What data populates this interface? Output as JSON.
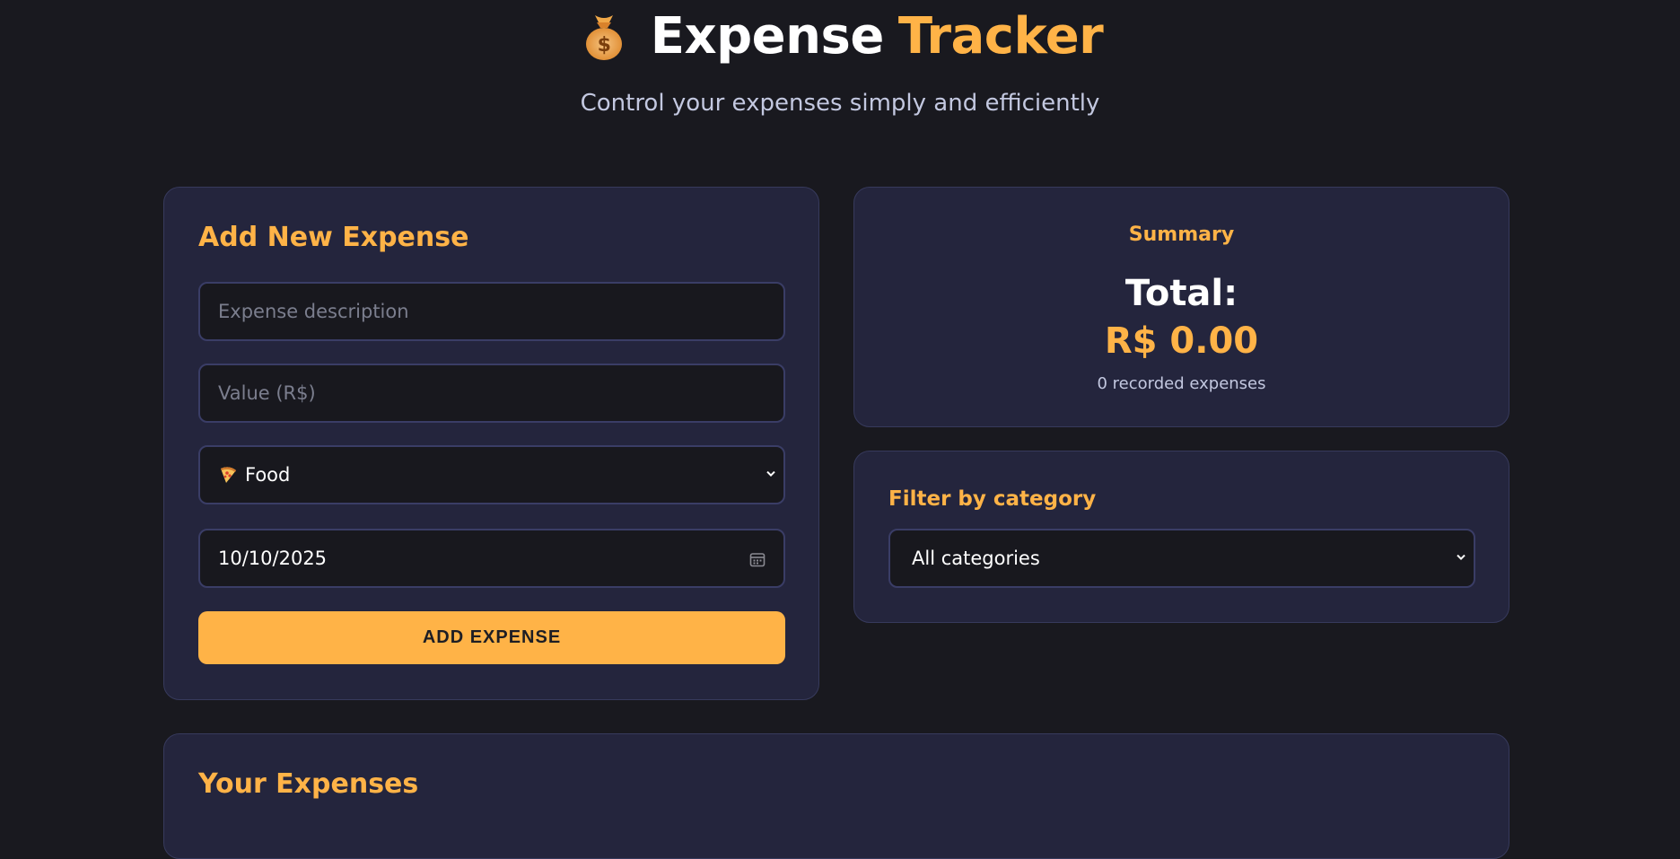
{
  "header": {
    "title_main": "Expense",
    "title_accent": "Tracker",
    "subtitle": "Control your expenses simply and efficiently",
    "icon": "money-bag-icon"
  },
  "add_form": {
    "heading": "Add New Expense",
    "description_placeholder": "Expense description",
    "value_placeholder": "Value (R$)",
    "category_selected": "Food",
    "category_icon": "pizza-icon",
    "date_value": "10/10/2025",
    "submit_label": "ADD EXPENSE"
  },
  "summary": {
    "heading": "Summary",
    "total_label": "Total:",
    "total_value": "R$ 0.00",
    "count_text": "0 recorded expenses"
  },
  "filter": {
    "heading": "Filter by category",
    "selected": "All categories"
  },
  "list": {
    "heading": "Your Expenses"
  },
  "colors": {
    "background": "#19191f",
    "card": "#24253d",
    "accent": "#ffb347",
    "input_bg": "#18181e",
    "border": "#3a3d66"
  }
}
